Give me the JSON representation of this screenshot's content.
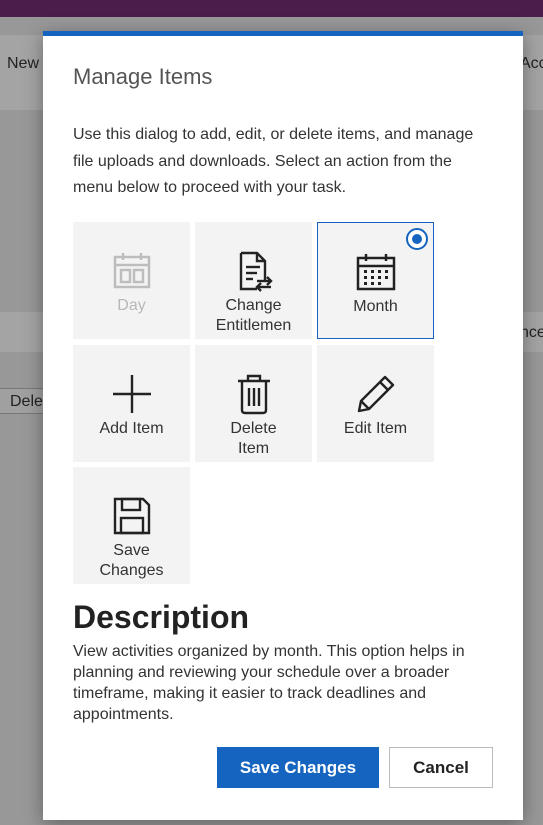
{
  "background": {
    "text_left_top": "New",
    "text_right_top": "Acc",
    "text_right_mid": "nce",
    "text_left_mid": "Dele"
  },
  "dialog": {
    "title": "Manage Items",
    "intro": "Use this dialog to add, edit, or delete items, and manage file uploads and downloads. Select an action from the menu below to proceed with your task.",
    "tiles": [
      {
        "label": "Day",
        "icon": "calendar-day-icon",
        "state": "disabled"
      },
      {
        "label": "Change\nEntitlemen",
        "icon": "document-swap-icon",
        "state": "normal"
      },
      {
        "label": "Month",
        "icon": "calendar-month-icon",
        "state": "selected"
      },
      {
        "label": "Add Item",
        "icon": "plus-icon",
        "state": "normal"
      },
      {
        "label": "Delete\nItem",
        "icon": "trash-icon",
        "state": "normal"
      },
      {
        "label": "Edit Item",
        "icon": "pencil-icon",
        "state": "normal"
      },
      {
        "label": "Save\nChanges",
        "icon": "save-icon",
        "state": "normal"
      }
    ],
    "description_heading": "Description",
    "description_text": "View activities organized by month. This option helps in planning and reviewing your schedule over a broader timeframe, making it easier to track deadlines and appointments.",
    "save_label": "Save Changes",
    "cancel_label": "Cancel"
  },
  "colors": {
    "accent": "#1565c0",
    "tile_bg": "#f3f3f3",
    "disabled_text": "#b8b8b8",
    "topbar": "#4a1d4a"
  }
}
